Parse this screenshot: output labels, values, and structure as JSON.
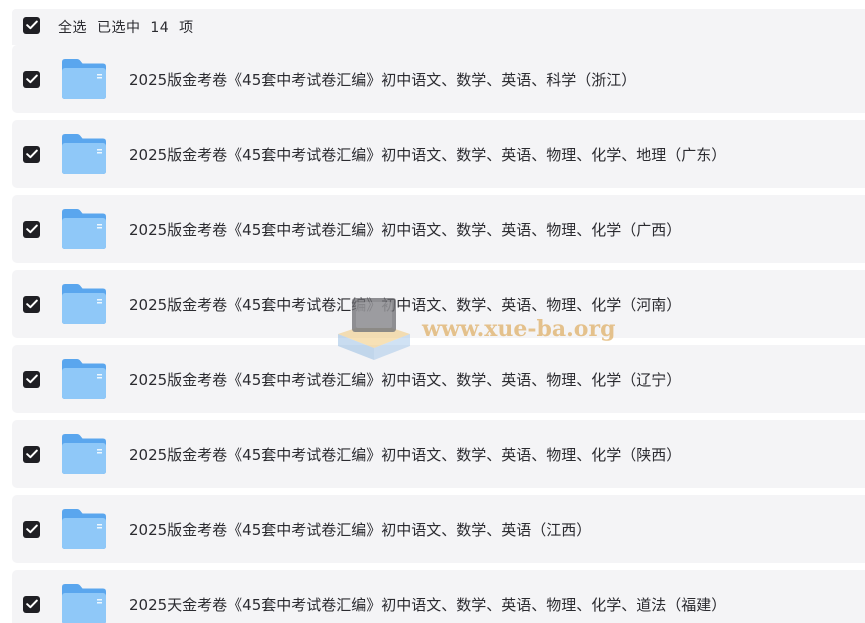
{
  "selection": {
    "select_all_label": "全选",
    "selected_summary": "已选中  14  项"
  },
  "rows": [
    {
      "title": "2025版金考卷《45套中考试卷汇编》初中语文、数学、英语、科学（浙江）"
    },
    {
      "title": "2025版金考卷《45套中考试卷汇编》初中语文、数学、英语、物理、化学、地理（广东）"
    },
    {
      "title": "2025版金考卷《45套中考试卷汇编》初中语文、数学、英语、物理、化学（广西）"
    },
    {
      "title": "2025版金考卷《45套中考试卷汇编》初中语文、数学、英语、物理、化学（河南）"
    },
    {
      "title": "2025版金考卷《45套中考试卷汇编》初中语文、数学、英语、物理、化学（辽宁）"
    },
    {
      "title": "2025版金考卷《45套中考试卷汇编》初中语文、数学、英语、物理、化学（陕西）"
    },
    {
      "title": "2025版金考卷《45套中考试卷汇编》初中语文、数学、英语（江西）"
    },
    {
      "title": "2025天金考卷《45套中考试卷汇编》初中语文、数学、英语、物理、化学、道法（福建）"
    }
  ],
  "watermark": {
    "text": "www.xue-ba.org"
  },
  "icons": {
    "checkbox": "checkbox-checked-icon",
    "folder": "folder-icon"
  },
  "colors": {
    "row_background": "#f4f4f6",
    "checkbox": "#1f1f24",
    "folder_back": "#5aa6ee",
    "folder_front": "#8fc8f8",
    "text": "#2b2b30",
    "watermark": "#deaa5a"
  }
}
